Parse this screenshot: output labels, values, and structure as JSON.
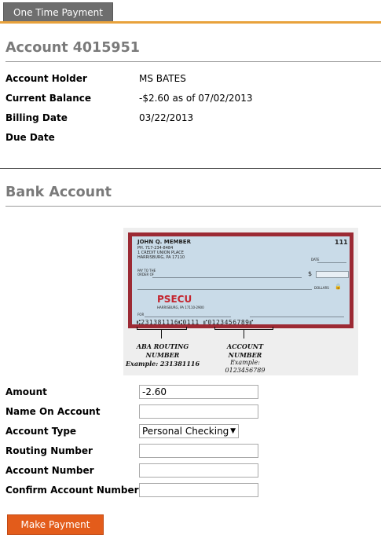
{
  "tabs": [
    {
      "label": "One Time Payment"
    }
  ],
  "account": {
    "title": "Account 4015951",
    "fields": [
      {
        "label": "Account Holder",
        "value": "MS BATES"
      },
      {
        "label": "Current Balance",
        "value": "-$2.60 as of 07/02/2013"
      },
      {
        "label": "Billing Date",
        "value": "03/22/2013"
      },
      {
        "label": "Due Date",
        "value": ""
      }
    ]
  },
  "bank": {
    "title": "Bank Account",
    "check": {
      "name": "JOHN Q. MEMBER",
      "phone": "PH. 717-234-8484",
      "address1": "1 CREDIT UNION PLACE",
      "address2": "HARRISBURG, PA 17110",
      "check_no": "111",
      "date_label": "DATE",
      "pay_label_1": "PAY TO THE",
      "pay_label_2": "ORDER OF",
      "dollar_sign": "$",
      "dollars_label": "DOLLARS",
      "bank_name": "PSECU",
      "bank_address": "HARRISBURG, PA 17110-2900",
      "for_label": "FOR",
      "micr": "⑆231381116⑆0111 ⑈0123456789⑈",
      "routing_caption_1": "ABA ROUTING",
      "routing_caption_2": "NUMBER",
      "routing_example": "Example: 231381116",
      "account_caption_1": "ACCOUNT",
      "account_caption_2": "NUMBER",
      "account_example_1": "Example:",
      "account_example_2": "0123456789"
    },
    "form": {
      "amount_label": "Amount",
      "amount_value": "-2.60",
      "name_label": "Name On Account",
      "name_value": "",
      "type_label": "Account Type",
      "type_value": "Personal Checking",
      "routing_label": "Routing Number",
      "routing_value": "",
      "account_label": "Account Number",
      "account_value": "",
      "confirm_label": "Confirm Account Number",
      "confirm_value": ""
    },
    "submit_label": "Make Payment"
  },
  "colors": {
    "accent_orange": "#e8a23c",
    "button": "#e35c1b",
    "tab": "#6e6e6e",
    "check_border": "#9c2a34",
    "check_paper": "#c9dbe8",
    "psecu_red": "#c4242e"
  }
}
